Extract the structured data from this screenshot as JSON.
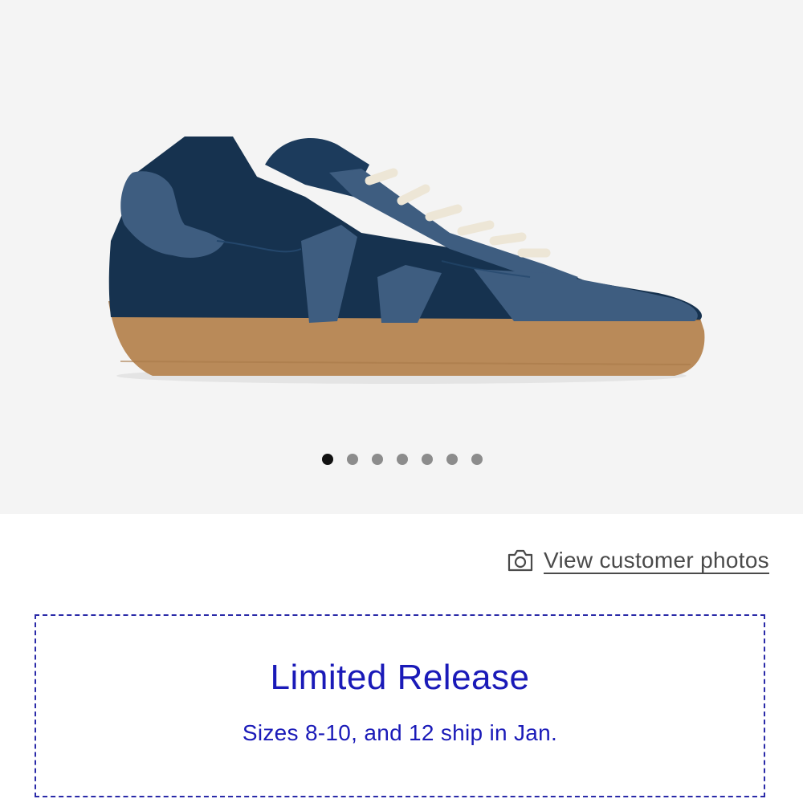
{
  "gallery": {
    "image_icon": "sneaker-product-image",
    "dot_count": 7,
    "active_index": 0,
    "colors": {
      "upper_dark": "#14314f",
      "suede": "#3e5d80",
      "sole": "#b98a59",
      "laces": "#ede6d6",
      "background": "#f4f4f4"
    }
  },
  "customer_photos": {
    "icon": "camera-icon",
    "label": "View customer photos"
  },
  "release": {
    "title": "Limited Release",
    "subtitle": "Sizes 8-10, and 12 ship in Jan.",
    "accent_color": "#1a1ab8"
  }
}
